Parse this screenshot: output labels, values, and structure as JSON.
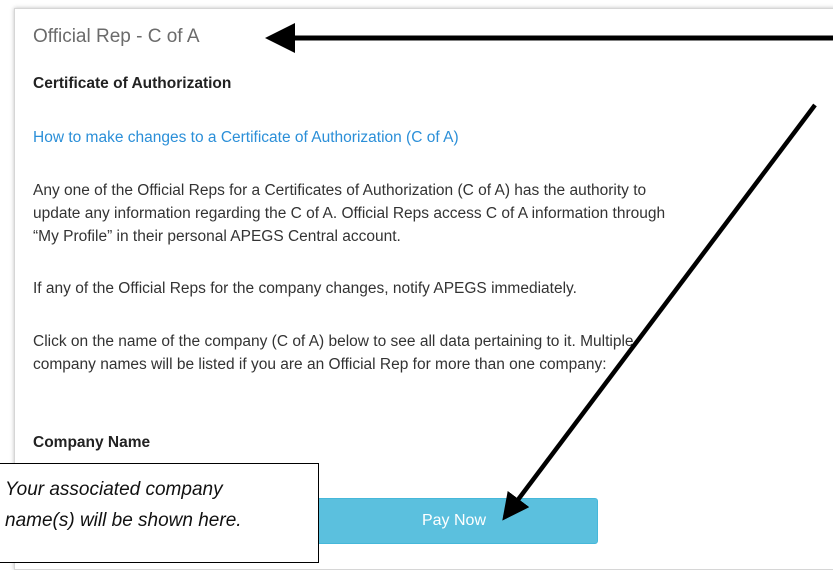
{
  "panel": {
    "title": "Official Rep - C of A",
    "section_heading": "Certificate of Authorization",
    "help_link": "How to make changes to a Certificate of Authorization (C of A)",
    "paragraph1": [
      "Any one of the Official Reps for a Certificates of Authorization (C of A) has the authority to",
      "update any information regarding the C of A. Official Reps access C of A information through",
      "“My Profile” in their personal APEGS Central account."
    ],
    "paragraph2": [
      "If any of the Official Reps for the company changes, notify APEGS immediately."
    ],
    "paragraph3": [
      "Click on the name of the company (C of A) below to see all data pertaining to it. Multiple",
      "company names will be listed if you are an Official Rep for more than one company:"
    ],
    "company_heading": "Company Name",
    "pay_button": "Pay Now"
  },
  "annotation": {
    "lines": [
      "Your associated company",
      "name(s) will be shown here."
    ]
  },
  "colors": {
    "link": "#2b8fd8",
    "button": "#5bc0de",
    "title": "#6b6b6b"
  }
}
